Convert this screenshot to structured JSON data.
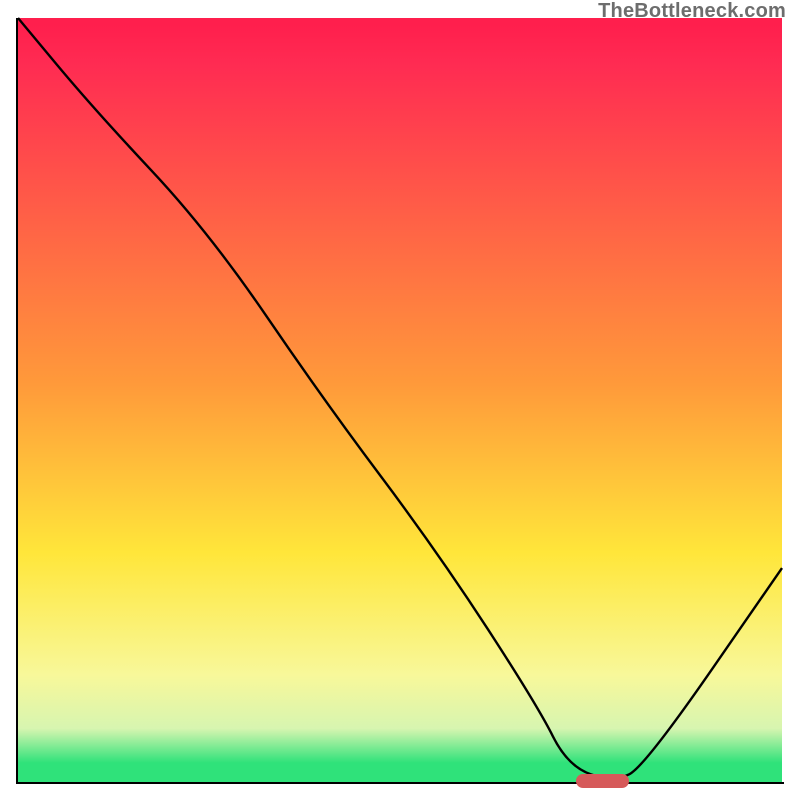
{
  "watermark": "TheBottleneck.com",
  "colors": {
    "top": "#ff1f4d",
    "red": "#ff2b52",
    "orange": "#ff9a3a",
    "yellow": "#ffe63a",
    "lemon": "#f8f89a",
    "pale": "#d7f5b0",
    "green": "#2fe27a",
    "marker": "#d65a5a",
    "curve": "#000000"
  },
  "chart_data": {
    "type": "line",
    "title": "",
    "xlabel": "",
    "ylabel": "",
    "xlim": [
      0,
      100
    ],
    "ylim": [
      0,
      100
    ],
    "grid": false,
    "legend": false,
    "annotations": [
      {
        "text": "TheBottleneck.com",
        "position": "top-right"
      }
    ],
    "series": [
      {
        "name": "bottleneck-curve",
        "x": [
          0,
          10,
          25,
          40,
          55,
          68,
          72,
          78,
          82,
          100
        ],
        "values": [
          100,
          88,
          72,
          50,
          30,
          10,
          2,
          0,
          2,
          28
        ],
        "comment": "y is bottleneck % (0 = ideal, green); x is component balance axis"
      }
    ],
    "optimum_marker": {
      "x_start": 73,
      "x_end": 80,
      "y": 0,
      "comment": "red pill marker on baseline showing the sweet-spot range"
    }
  }
}
